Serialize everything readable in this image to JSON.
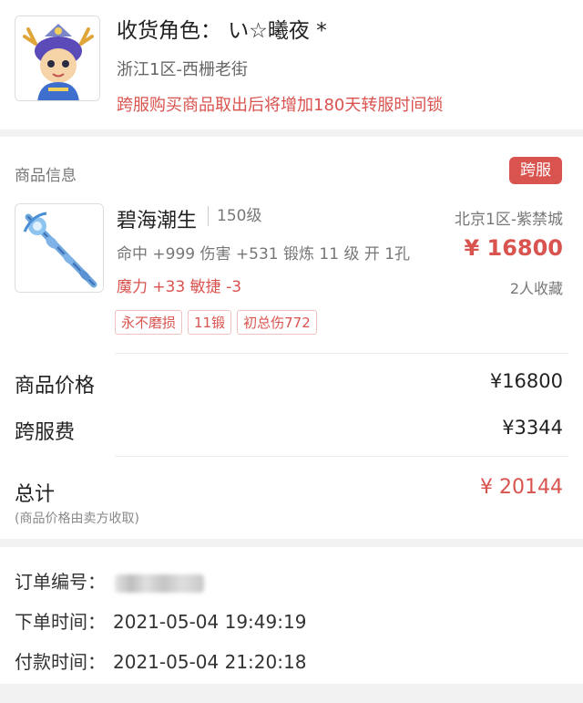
{
  "receiver": {
    "title": "收货角色： い☆曦夜 *",
    "server": "浙江1区-西栅老街",
    "warning": "跨服购买商品取出后将增加180天转服时间锁",
    "avatar_icon": "character-avatar-icon"
  },
  "goods": {
    "section_label": "商品信息",
    "badge": "跨服",
    "item": {
      "icon": "staff-weapon-icon",
      "name": "碧海潮生",
      "level": "150级",
      "server": "北京1区-紫禁城",
      "attrs": "命中 +999 伤害 +531 锻炼 11 级 开 1孔",
      "price": "¥ 16800",
      "stats": "魔力 +33 敏捷 -3",
      "favorites": "2人收藏",
      "tags": [
        "永不磨损",
        "11锻",
        "初总伤772"
      ]
    },
    "price_label": "商品价格",
    "price_value": "¥16800",
    "fee_label": "跨服费",
    "fee_value": "¥3344",
    "total_label": "总计",
    "total_value": "¥ 20144",
    "total_note": "(商品价格由卖方收取)"
  },
  "order": {
    "number_label": "订单编号：",
    "placed_label": "下单时间：",
    "placed_value": "2021-05-04 19:49:19",
    "paid_label": "付款时间：",
    "paid_value": "2021-05-04 21:20:18"
  },
  "colors": {
    "accent": "#d9534f",
    "text": "#222222",
    "muted": "#777777",
    "background": "#f2f2f2"
  }
}
